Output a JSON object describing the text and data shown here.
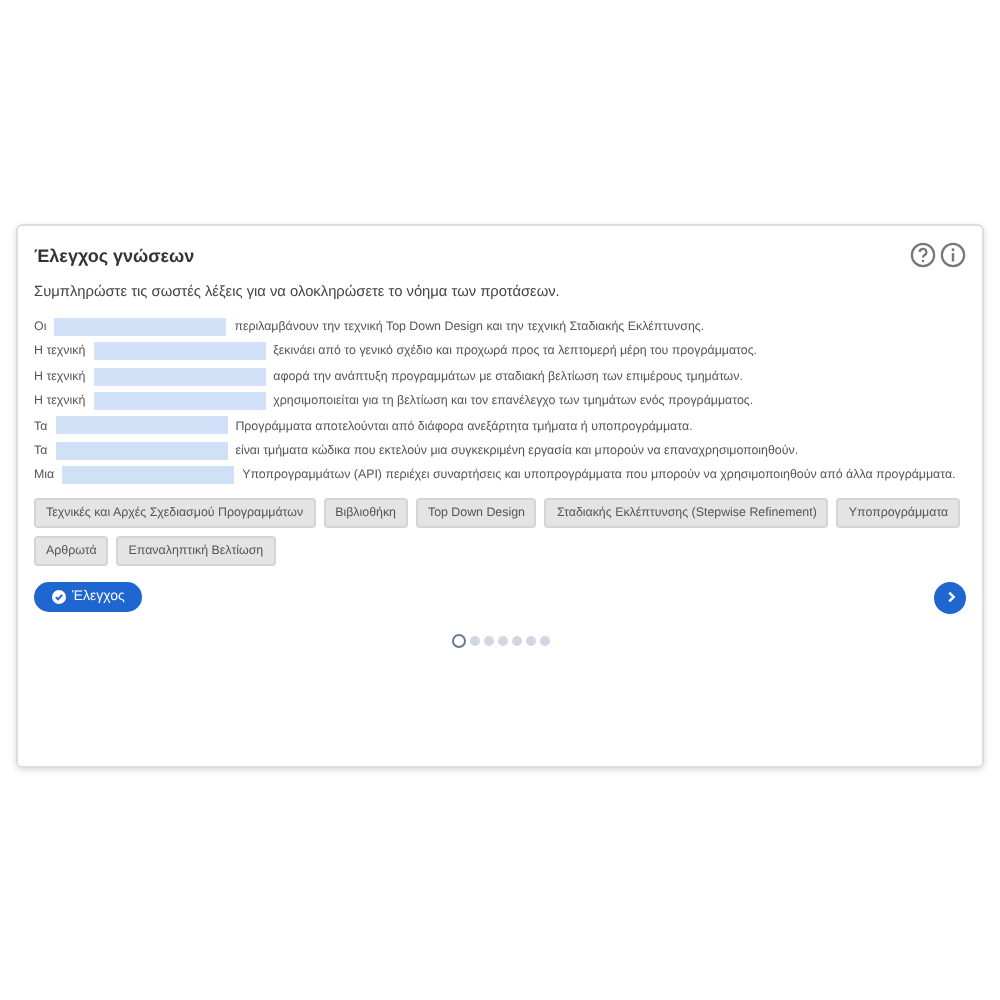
{
  "title": "Έλεγχος γνώσεων",
  "instruction": "Συμπληρώστε τις σωστές λέξεις για να ολοκληρώσετε το νόημα των προτάσεων.",
  "sentences": [
    {
      "before": "Οι",
      "after": "περιλαμβάνουν την τεχνική Top Down Design και την τεχνική Σταδιακής Εκλέπτυνσης."
    },
    {
      "before": "Η τεχνική",
      "after": "ξεκινάει από το γενικό σχέδιο και προχωρά προς τα λεπτομερή μέρη του προγράμματος."
    },
    {
      "before": "Η τεχνική",
      "after": "αφορά την ανάπτυξη προγραμμάτων με σταδιακή βελτίωση των επιμέρους τμημάτων."
    },
    {
      "before": "Η τεχνική",
      "after": "χρησιμοποιείται για τη βελτίωση και τον επανέλεγχο των τμημάτων ενός προγράμματος."
    },
    {
      "before": "Τα",
      "after": "Προγράμματα αποτελούνται από διάφορα ανεξάρτητα τμήματα ή υποπρογράμματα."
    },
    {
      "before": "Τα",
      "after": "είναι τμήματα κώδικα που εκτελούν μια συγκεκριμένη εργασία και μπορούν να επαναχρησιμοποιηθούν."
    },
    {
      "before": "Μια",
      "after": "Υποπρογραμμάτων (API) περιέχει συναρτήσεις και υποπρογράμματα που μπορούν να χρησιμοποιηθούν από άλλα προγράμματα."
    }
  ],
  "word_bank": [
    "Τεχνικές και Αρχές Σχεδιασμού Προγραμμάτων",
    "Βιβλιοθήκη",
    "Top Down Design",
    "Σταδιακής Εκλέπτυνσης (Stepwise Refinement)",
    "Υποπρογράμματα",
    "Αρθρωτά",
    "Επαναληπτική Βελτίωση"
  ],
  "check_button": "Έλεγχος",
  "pages": [
    {
      "selected": true
    },
    {
      "selected": false
    },
    {
      "selected": false
    },
    {
      "selected": false
    },
    {
      "selected": false
    },
    {
      "selected": false
    },
    {
      "selected": false
    }
  ]
}
